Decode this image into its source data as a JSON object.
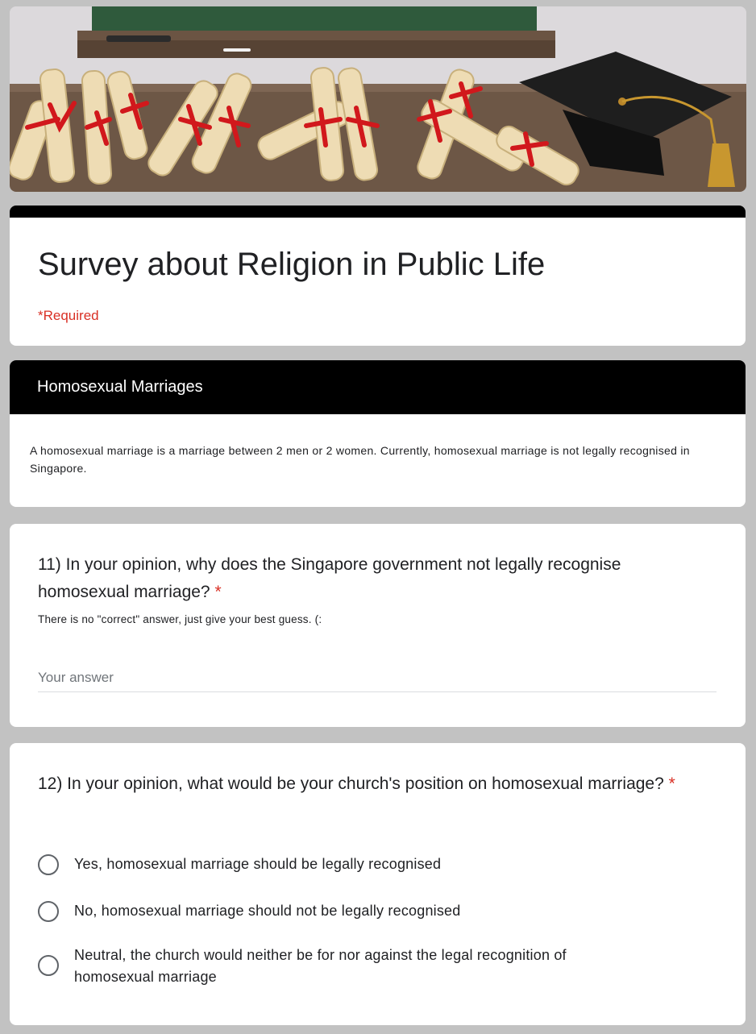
{
  "form": {
    "title": "Survey about Religion in Public Life",
    "required_note": "*Required",
    "colors": {
      "accent": "#000000",
      "required": "#d93025",
      "background": "#c2c2c2"
    }
  },
  "banner": {
    "image_desc_icon": "graduation-scrolls-illustration"
  },
  "section": {
    "header": "Homosexual Marriages",
    "description": "A homosexual marriage is a marriage between 2 men or 2 women. Currently, homosexual marriage is not legally recognised in Singapore."
  },
  "q11": {
    "title": "11) In your opinion, why does the Singapore government not legally recognise homosexual marriage?",
    "required_mark": "*",
    "help": "There is no \"correct\" answer, just give your best guess. (:",
    "placeholder": "Your answer"
  },
  "q12": {
    "title": "12) In your opinion, what would be your church's position on homosexual marriage?",
    "required_mark": "*",
    "options": [
      {
        "label": "Yes, homosexual marriage should be legally recognised"
      },
      {
        "label": "No, homosexual marriage should not be legally recognised"
      },
      {
        "label": "Neutral, the church would neither be for nor against the legal recognition of homosexual marriage"
      }
    ]
  }
}
